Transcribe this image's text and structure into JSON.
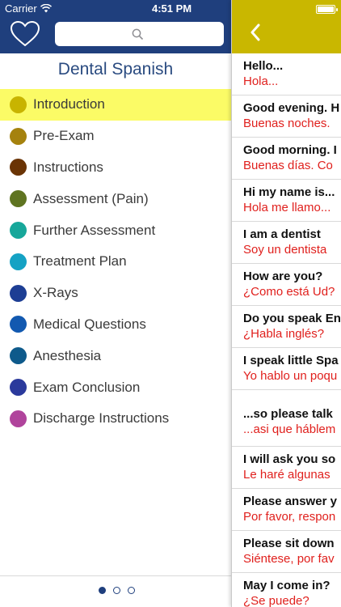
{
  "status_bar": {
    "carrier": "Carrier",
    "time": "4:51 PM",
    "wifi_icon": "wifi-icon",
    "battery_icon": "battery-icon"
  },
  "colors": {
    "left_header": "#1f3f7d",
    "right_header": "#c9b700",
    "active_row": "#fbfb66",
    "phrase_translation": "#e0201d",
    "title": "#2a4b80"
  },
  "left": {
    "favorite_icon": "heart-icon",
    "search": {
      "placeholder": "",
      "icon": "search-icon"
    },
    "title": "Dental Spanish",
    "items": [
      {
        "label": "Introduction",
        "color": "#c8b400",
        "active": true
      },
      {
        "label": "Pre-Exam",
        "color": "#a5820e"
      },
      {
        "label": "Instructions",
        "color": "#6a3405"
      },
      {
        "label": "Assessment (Pain)",
        "color": "#5f7421"
      },
      {
        "label": "Further Assessment",
        "color": "#17a79a"
      },
      {
        "label": "Treatment Plan",
        "color": "#15a2c4"
      },
      {
        "label": "X-Rays",
        "color": "#1d3e94"
      },
      {
        "label": "Medical Questions",
        "color": "#1259b0"
      },
      {
        "label": "Anesthesia",
        "color": "#0e5a8b"
      },
      {
        "label": "Exam Conclusion",
        "color": "#2b3a9c"
      },
      {
        "label": "Discharge Instructions",
        "color": "#b0449c"
      }
    ],
    "pager": {
      "pages": 3,
      "current": 1
    }
  },
  "right": {
    "back_icon": "chevron-left-icon",
    "phrases": [
      {
        "en": "Hello...",
        "es": "Hola..."
      },
      {
        "en": "Good evening. H",
        "es": "Buenas noches."
      },
      {
        "en": "Good morning. I",
        "es": "Buenas días. Co"
      },
      {
        "en": "Hi my name is...",
        "es": "Hola me llamo..."
      },
      {
        "en": "I am a dentist",
        "es": "Soy un dentista"
      },
      {
        "en": "How are you?",
        "es": "¿Como está Ud?"
      },
      {
        "en": "Do you speak En",
        "es": "¿Habla inglés?"
      },
      {
        "en": "I speak little Spa",
        "es": "Yo hablo un poqu"
      },
      {
        "en": "...so please talk",
        "es": "...asi que háblem",
        "tall": true
      },
      {
        "en": "I will ask you so",
        "es": "Le haré algunas"
      },
      {
        "en": "Please answer y",
        "es": "Por favor, respon"
      },
      {
        "en": "Please sit down",
        "es": "Siéntese, por fav"
      },
      {
        "en": "May I come in?",
        "es": "¿Se puede?"
      }
    ]
  }
}
